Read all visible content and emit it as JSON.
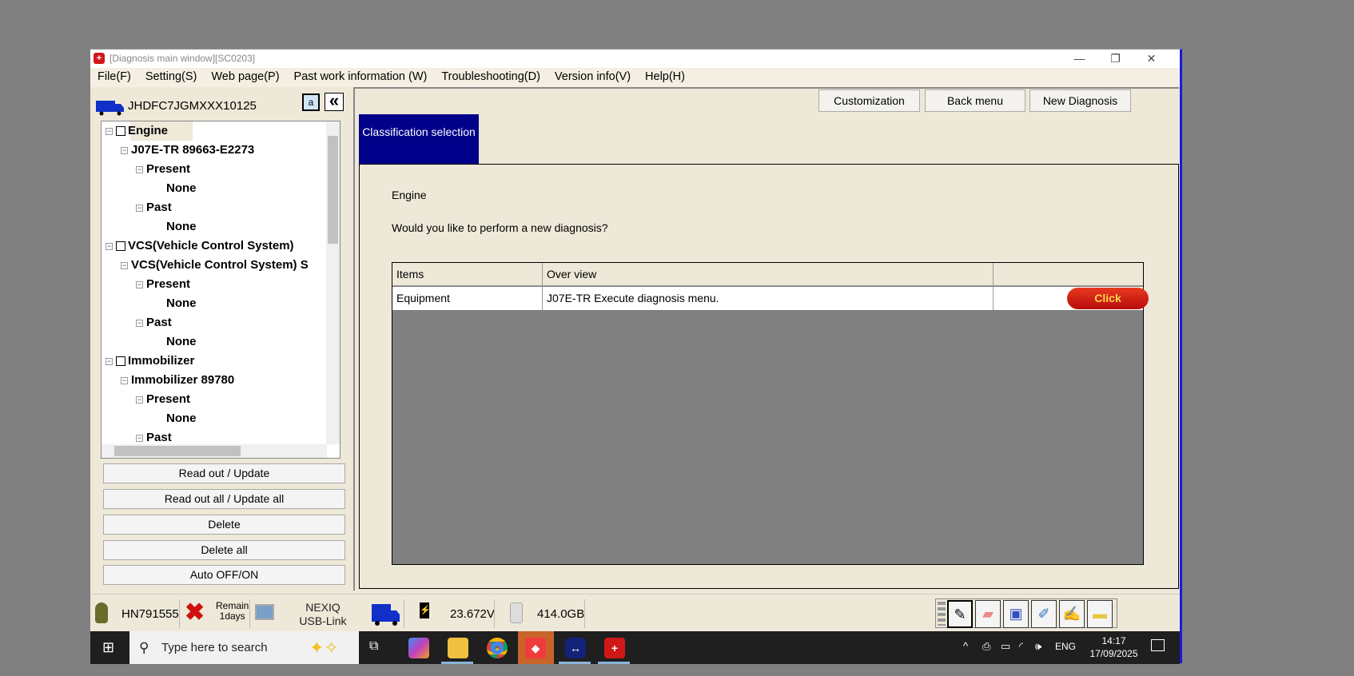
{
  "window": {
    "title": "[Diagnosis main window][SC0203]",
    "minimize": "—",
    "restore": "❐",
    "close": "✕"
  },
  "menu": [
    "File(F)",
    "Setting(S)",
    "Web page(P)",
    "Past work information (W)",
    "Troubleshooting(D)",
    "Version info(V)",
    "Help(H)"
  ],
  "left": {
    "vin": "JHDFC7JGMXXX10125",
    "a_button": "a",
    "collapse_button": "«",
    "tree": [
      {
        "label": "Engine",
        "level": 0,
        "checkbox": true
      },
      {
        "label": "J07E-TR 89663-E2273",
        "level": 1
      },
      {
        "label": "Present",
        "level": 2
      },
      {
        "label": "None",
        "level": 3
      },
      {
        "label": "Past",
        "level": 2
      },
      {
        "label": "None",
        "level": 3
      },
      {
        "label": "VCS(Vehicle Control System)",
        "level": 0,
        "checkbox": true
      },
      {
        "label": "VCS(Vehicle Control System) S",
        "level": 1
      },
      {
        "label": "Present",
        "level": 2
      },
      {
        "label": "None",
        "level": 3
      },
      {
        "label": "Past",
        "level": 2
      },
      {
        "label": "None",
        "level": 3
      },
      {
        "label": "Immobilizer",
        "level": 0,
        "checkbox": true
      },
      {
        "label": "Immobilizer 89780",
        "level": 1
      },
      {
        "label": "Present",
        "level": 2
      },
      {
        "label": "None",
        "level": 3
      },
      {
        "label": "Past",
        "level": 2
      }
    ],
    "buttons": [
      "Read out / Update",
      "Read out all / Update all",
      "Delete",
      "Delete all",
      "Auto OFF/ON"
    ]
  },
  "right": {
    "buttons": [
      "Customization",
      "Back menu",
      "New Diagnosis"
    ],
    "tab": "Classification selection",
    "system": "Engine",
    "question": "Would you like to perform a new diagnosis?",
    "table": {
      "headers": [
        "Items",
        "Over view",
        ""
      ],
      "rows": [
        {
          "item": "Equipment",
          "overview": "J07E-TR Execute diagnosis menu.",
          "action": "Click"
        }
      ]
    }
  },
  "status": {
    "user": "HN791555",
    "remain": "Remain",
    "remain_days": "1days",
    "interface": "NEXIQ USB-Link",
    "voltage": "23.672V",
    "disk": "414.0GB"
  },
  "taskbar": {
    "search_placeholder": "Type here to search",
    "lang": "ENG",
    "time": "14:17",
    "date": "17/09/2025"
  }
}
